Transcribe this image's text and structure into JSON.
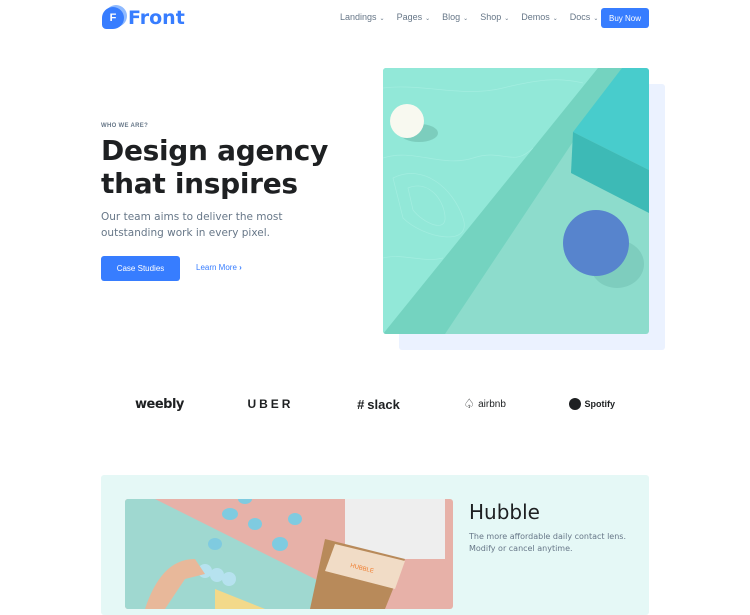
{
  "header": {
    "logo_letter": "F",
    "logo_text": "Front",
    "nav": [
      {
        "label": "Landings"
      },
      {
        "label": "Pages"
      },
      {
        "label": "Blog"
      },
      {
        "label": "Shop"
      },
      {
        "label": "Demos"
      },
      {
        "label": "Docs"
      }
    ],
    "buy_now": "Buy Now"
  },
  "hero": {
    "eyebrow": "WHO WE ARE?",
    "title_line1": "Design agency",
    "title_line2": "that inspires",
    "lead": "Our team aims to deliver the most outstanding work in every pixel.",
    "primary_button": "Case Studies",
    "secondary_link": "Learn More",
    "secondary_chevron": "›"
  },
  "brands": [
    {
      "name": "weebly"
    },
    {
      "name": "UBER"
    },
    {
      "name": "slack"
    },
    {
      "name": "airbnb"
    },
    {
      "name": "Spotify"
    }
  ],
  "feature": {
    "title": "Hubble",
    "text_line1": "The more affordable daily contact lens.",
    "text_line2": "Modify or cancel anytime.",
    "box_label": "HUBBLE"
  },
  "colors": {
    "primary": "#377dff",
    "feature_bg": "#e5f8f6"
  }
}
